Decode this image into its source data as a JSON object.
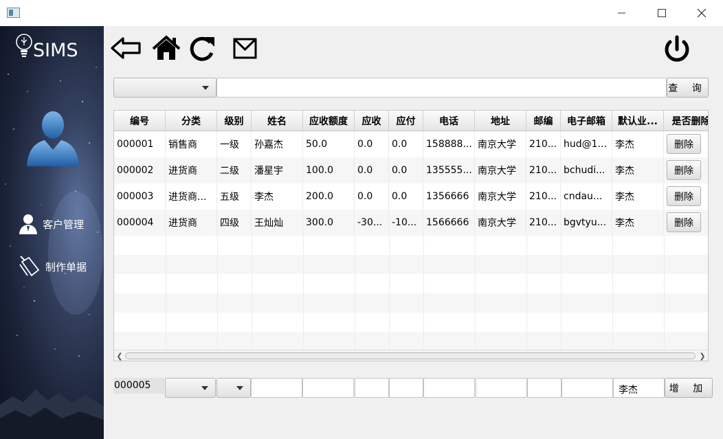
{
  "app": {
    "logo_text": "SIMS"
  },
  "sidebar": {
    "items": [
      {
        "label": "客户管理",
        "icon": "user-icon"
      },
      {
        "label": "制作单据",
        "icon": "document-edit-icon"
      }
    ]
  },
  "toolbar": {
    "icons": [
      "back-arrow-icon",
      "home-icon",
      "refresh-icon",
      "mail-icon",
      "power-icon"
    ]
  },
  "search": {
    "type_selected": "",
    "keyword": "",
    "button_label": "查 询"
  },
  "table": {
    "columns": [
      "编号",
      "分类",
      "级别",
      "姓名",
      "应收额度",
      "应收",
      "应付",
      "电话",
      "地址",
      "邮编",
      "电子邮箱",
      "默认业...",
      "是否删除"
    ],
    "rows": [
      {
        "id": "000001",
        "category": "销售商",
        "level": "一级",
        "name": "孙嘉杰",
        "credit": "50.0",
        "receivable": "0.0",
        "payable": "0.0",
        "phone": "158888...",
        "address": "南京大学",
        "zip": "210...",
        "email": "hud@1...",
        "salesperson": "李杰",
        "action": "删除"
      },
      {
        "id": "000002",
        "category": "进货商",
        "level": "二级",
        "name": "潘星宇",
        "credit": "100.0",
        "receivable": "0.0",
        "payable": "0.0",
        "phone": "135555...",
        "address": "南京大学",
        "zip": "210...",
        "email": "bchudi...",
        "salesperson": "李杰",
        "action": "删除"
      },
      {
        "id": "000003",
        "category": "进货商...",
        "level": "五级",
        "name": "李杰",
        "credit": "200.0",
        "receivable": "0.0",
        "payable": "0.0",
        "phone": "1356666",
        "address": "南京大学",
        "zip": "210...",
        "email": "cndau...",
        "salesperson": "李杰",
        "action": "删除"
      },
      {
        "id": "000004",
        "category": "进货商",
        "level": "四级",
        "name": "王灿灿",
        "credit": "300.0",
        "receivable": "-30...",
        "payable": "-10...",
        "phone": "1566666",
        "address": "南京大学",
        "zip": "210...",
        "email": "bgvtyu...",
        "salesperson": "李杰",
        "action": "删除"
      }
    ]
  },
  "add_row": {
    "next_id": "000005",
    "salesperson": "李杰",
    "button_label": "增 加"
  }
}
